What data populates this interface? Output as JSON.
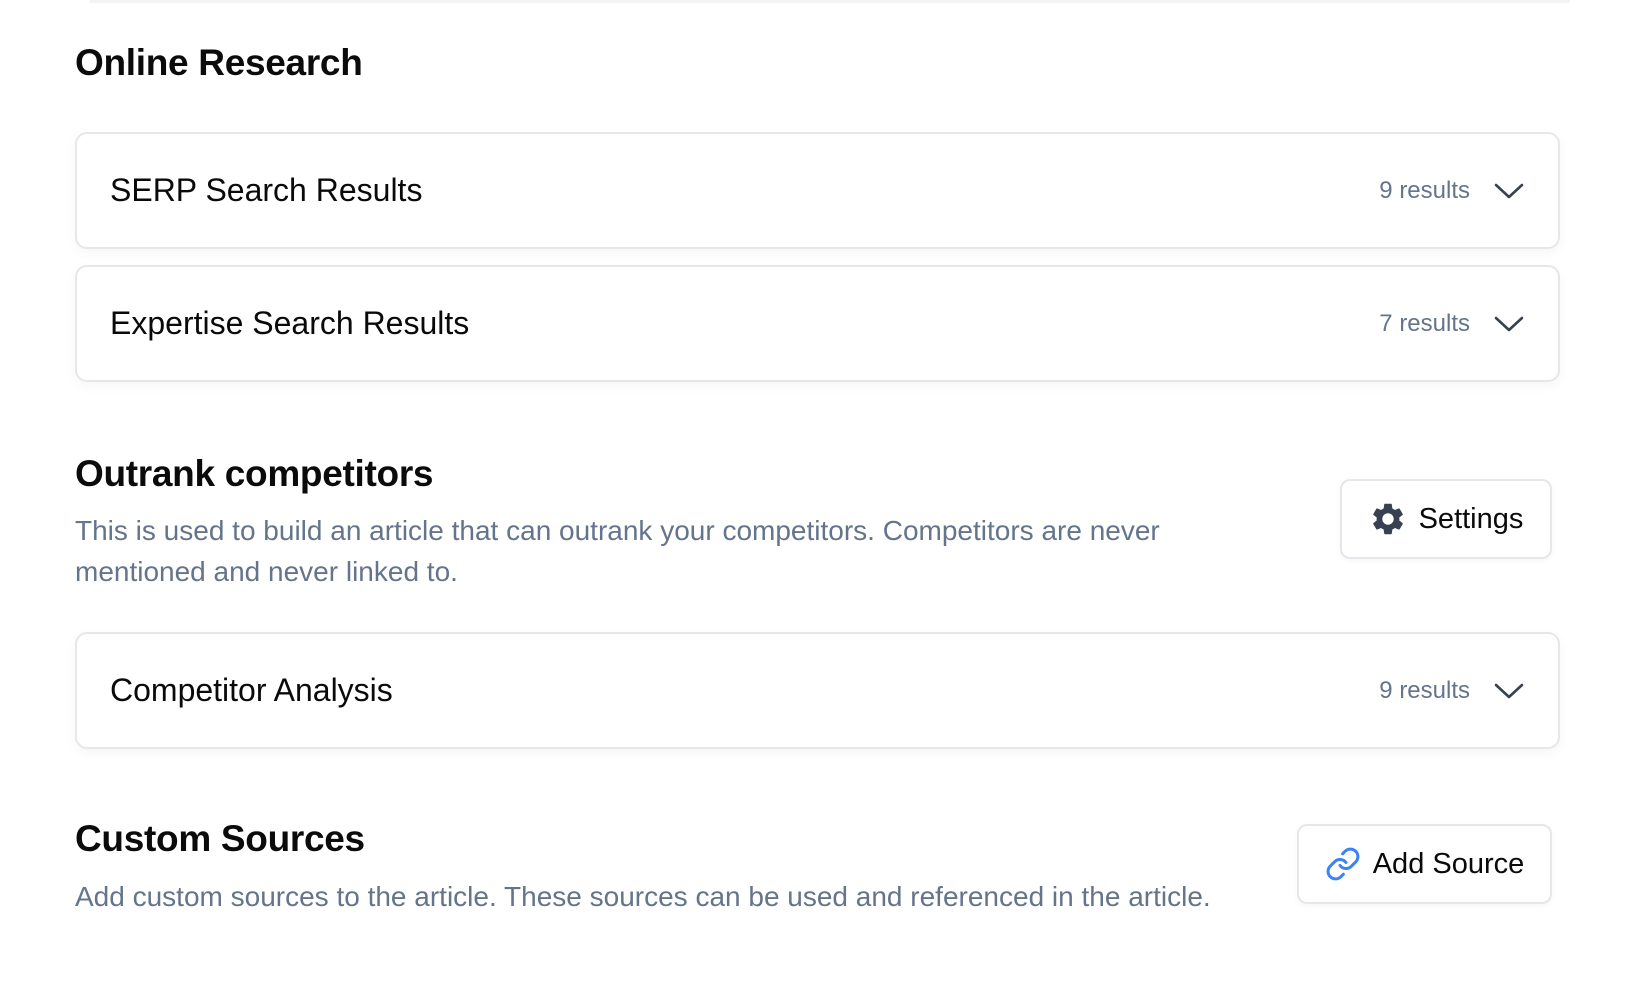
{
  "online_research": {
    "title": "Online Research",
    "items": [
      {
        "label": "SERP Search Results",
        "count": "9 results"
      },
      {
        "label": "Expertise Search Results",
        "count": "7 results"
      }
    ]
  },
  "outrank": {
    "title": "Outrank competitors",
    "description_line1": "This is used to build an article that can outrank your competitors. Competitors are never",
    "description_line2": "mentioned and never linked to.",
    "settings_label": "Settings",
    "settings_icon": "gear-icon",
    "items": [
      {
        "label": "Competitor Analysis",
        "count": "9 results"
      }
    ]
  },
  "custom_sources": {
    "title": "Custom Sources",
    "description": "Add custom sources to the article. These sources can be used and referenced in the article.",
    "add_label": "Add Source",
    "add_icon": "link-icon"
  },
  "colors": {
    "muted_text": "#64748b",
    "border": "#e5e7eb",
    "link_icon": "#3b82f6",
    "gear_icon": "#374151"
  }
}
